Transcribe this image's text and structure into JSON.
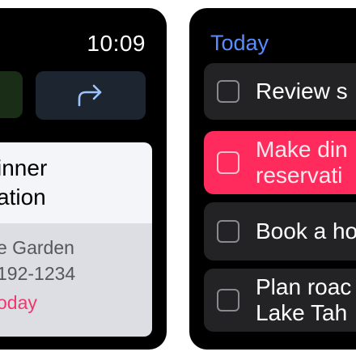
{
  "reminder_detail": {
    "time": "10:09",
    "share_icon": "share-arrow-icon",
    "title": "inner\nation",
    "location": "e Garden",
    "phone": " 192-1234",
    "due": "oday"
  },
  "reminders_list": {
    "header": "Today",
    "tasks": [
      {
        "label": "Review s",
        "selected": false
      },
      {
        "label": "Make din\nreservati",
        "selected": true
      },
      {
        "label": "Book a ho",
        "selected": false
      },
      {
        "label": "Plan roac\nLake Tah",
        "selected": false
      }
    ]
  },
  "colors": {
    "accent_blue": "#5b8cff",
    "selected_pink": "#ff2b5c",
    "due_pink": "#f0386b"
  }
}
